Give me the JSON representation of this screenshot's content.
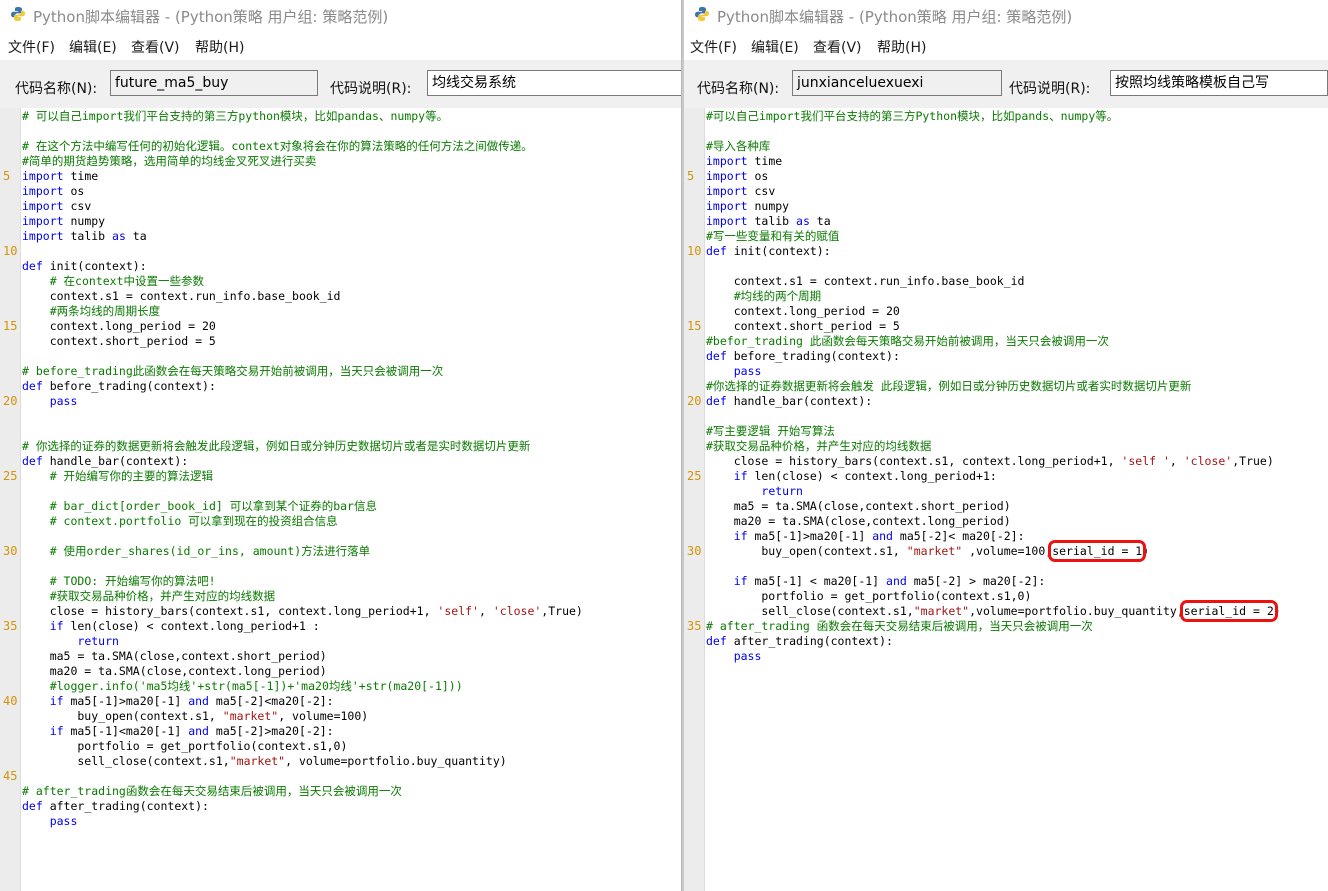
{
  "left_window": {
    "title": "Python脚本编辑器 - (Python策略 用户组: 策略范例)",
    "menu": [
      "文件(F)",
      "编辑(E)",
      "查看(V)",
      "帮助(H)"
    ],
    "code_name_label": "代码名称(N):",
    "code_name_value": "future_ma5_buy",
    "code_desc_label": "代码说明(R):",
    "code_desc_value": "均线交易系统",
    "lines": [
      "# 可以自己import我们平台支持的第三方python模块，比如pandas、numpy等。",
      "",
      "# 在这个方法中编写任何的初始化逻辑。context对象将会在你的算法策略的任何方法之间做传递。",
      "#简单的期货趋势策略，选用简单的均线金叉死叉进行买卖",
      "import time",
      "import os",
      "import csv",
      "import numpy",
      "import talib as ta",
      "",
      "def init(context):",
      "    # 在context中设置一些参数",
      "    context.s1 = context.run_info.base_book_id",
      "    #两条均线的周期长度",
      "    context.long_period = 20",
      "    context.short_period = 5",
      "",
      "# before_trading此函数会在每天策略交易开始前被调用，当天只会被调用一次",
      "def before_trading(context):",
      "    pass",
      "",
      "",
      "# 你选择的证券的数据更新将会触发此段逻辑，例如日或分钟历史数据切片或者是实时数据切片更新",
      "def handle_bar(context):",
      "    # 开始编写你的主要的算法逻辑",
      "",
      "    # bar_dict[order_book_id] 可以拿到某个证券的bar信息",
      "    # context.portfolio 可以拿到现在的投资组合信息",
      "",
      "    # 使用order_shares(id_or_ins, amount)方法进行落单",
      "",
      "    # TODO: 开始编写你的算法吧!",
      "    #获取交易品种价格，并产生对应的均线数据",
      "    close = history_bars(context.s1, context.long_period+1, 'self', 'close',True)",
      "    if len(close) < context.long_period+1 :",
      "        return",
      "    ma5 = ta.SMA(close,context.short_period)",
      "    ma20 = ta.SMA(close,context.long_period)",
      "    #logger.info('ma5均线'+str(ma5[-1])+'ma20均线'+str(ma20[-1]))",
      "    if ma5[-1]>ma20[-1] and ma5[-2]<ma20[-2]:",
      "        buy_open(context.s1, \"market\", volume=100)",
      "    if ma5[-1]<ma20[-1] and ma5[-2]>ma20[-2]:",
      "        portfolio = get_portfolio(context.s1,0)",
      "        sell_close(context.s1,\"market\", volume=portfolio.buy_quantity)",
      "",
      "# after_trading函数会在每天交易结束后被调用，当天只会被调用一次",
      "def after_trading(context):",
      "    pass"
    ]
  },
  "right_window": {
    "title": "Python脚本编辑器 - (Python策略 用户组: 策略范例)",
    "menu": [
      "文件(F)",
      "编辑(E)",
      "查看(V)",
      "帮助(H)"
    ],
    "code_name_label": "代码名称(N):",
    "code_name_value": "junxianceluexuexi",
    "code_desc_label": "代码说明(R):",
    "code_desc_value": "按照均线策略模板自己写",
    "lines": [
      "#可以自己import我们平台支持的第三方Python模块，比如pands、numpy等。",
      "",
      "#导入各种库",
      "import time",
      "import os",
      "import csv",
      "import numpy",
      "import talib as ta",
      "#写一些变量和有关的赋值",
      "def init(context):",
      "",
      "    context.s1 = context.run_info.base_book_id",
      "    #均线的两个周期",
      "    context.long_period = 20",
      "    context.short_period = 5",
      "#befor_trading 此函数会每天策略交易开始前被调用，当天只会被调用一次",
      "def before_trading(context):",
      "    pass",
      "#你选择的证券数据更新将会触发 此段逻辑，例如日或分钟历史数据切片或者实时数据切片更新",
      "def handle_bar(context):",
      "",
      "#写主要逻辑 开始写算法",
      "#获取交易品种价格，并产生对应的均线数据",
      "    close = history_bars(context.s1, context.long_period+1, 'self ', 'close',True)",
      "    if len(close) < context.long_period+1:",
      "        return",
      "    ma5 = ta.SMA(close,context.short_period)",
      "    ma20 = ta.SMA(close,context.long_period)",
      "    if ma5[-1]>ma20[-1] and ma5[-2]< ma20[-2]:",
      "        buy_open(context.s1, \"market\" ,volume=100,serial_id = 1)",
      "",
      "    if ma5[-1] < ma20[-1] and ma5[-2] > ma20[-2]:",
      "        portfolio = get_portfolio(context.s1,0)",
      "        sell_close(context.s1,\"market\",volume=portfolio.buy_quantity,serial_id = 2)",
      "# after_trading 函数会在每天交易结束后被调用，当天只会被调用一次",
      "def after_trading(context):",
      "    pass"
    ]
  },
  "line_number_marks": [
    "5",
    "10",
    "15",
    "20",
    "25",
    "30",
    "35",
    "40",
    "45"
  ],
  "highlighted_fragments": [
    "serial_id = 1",
    "serial_id = 2"
  ],
  "colors": {
    "comment": "#0a7a00",
    "keyword": "#0000ee",
    "string": "#a31515",
    "line_number": "#d4930a",
    "highlight_box": "#ee1111"
  }
}
